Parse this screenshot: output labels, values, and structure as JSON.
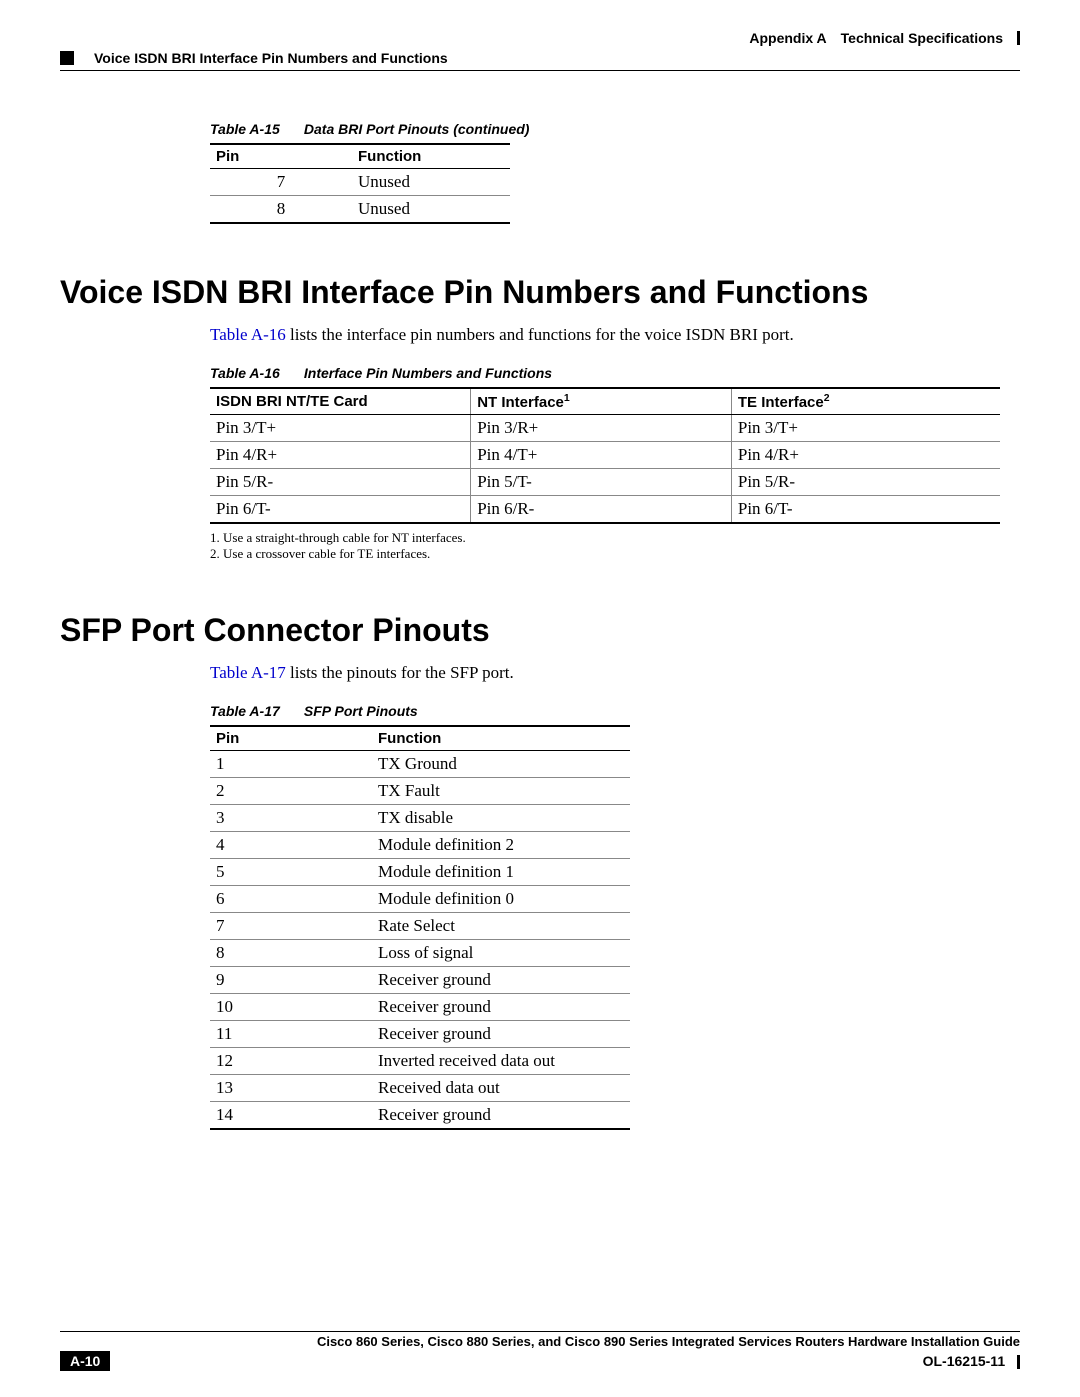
{
  "header": {
    "appendix": "Appendix A",
    "appendix_title": "Technical Specifications",
    "section_title": "Voice ISDN BRI Interface Pin Numbers and Functions"
  },
  "table_a15": {
    "number": "Table A-15",
    "title": "Data BRI Port Pinouts (continued)",
    "columns": [
      "Pin",
      "Function"
    ],
    "rows": [
      {
        "pin": "7",
        "func": "Unused"
      },
      {
        "pin": "8",
        "func": "Unused"
      }
    ]
  },
  "section1": {
    "heading": "Voice ISDN BRI Interface Pin Numbers and Functions",
    "intro_link": "Table A-16",
    "intro_rest": " lists the interface pin numbers and functions for the voice ISDN BRI port."
  },
  "table_a16": {
    "number": "Table A-16",
    "title": "Interface Pin Numbers and Functions",
    "col1": "ISDN BRI NT/TE Card",
    "col2": "NT Interface",
    "col2_sup": "1",
    "col3": "TE Interface",
    "col3_sup": "2",
    "rows": [
      {
        "c1": "Pin 3/T+",
        "c2": "Pin 3/R+",
        "c3": "Pin 3/T+"
      },
      {
        "c1": "Pin 4/R+",
        "c2": "Pin 4/T+",
        "c3": "Pin 4/R+"
      },
      {
        "c1": "Pin 5/R-",
        "c2": "Pin 5/T-",
        "c3": "Pin 5/R-"
      },
      {
        "c1": "Pin 6/T-",
        "c2": "Pin 6/R-",
        "c3": "Pin 6/T-"
      }
    ],
    "footnote1": "1.   Use a straight-through cable for NT interfaces.",
    "footnote2": "2.   Use a crossover cable for TE interfaces."
  },
  "section2": {
    "heading": "SFP Port Connector Pinouts",
    "intro_link": "Table A-17",
    "intro_rest": " lists the pinouts for the SFP port."
  },
  "table_a17": {
    "number": "Table A-17",
    "title": "SFP Port Pinouts",
    "columns": [
      "Pin",
      "Function"
    ],
    "rows": [
      {
        "pin": "1",
        "func": "TX Ground"
      },
      {
        "pin": "2",
        "func": "TX Fault"
      },
      {
        "pin": "3",
        "func": "TX disable"
      },
      {
        "pin": "4",
        "func": "Module definition 2"
      },
      {
        "pin": "5",
        "func": "Module definition 1"
      },
      {
        "pin": "6",
        "func": "Module definition 0"
      },
      {
        "pin": "7",
        "func": "Rate Select"
      },
      {
        "pin": "8",
        "func": "Loss of signal"
      },
      {
        "pin": "9",
        "func": "Receiver ground"
      },
      {
        "pin": "10",
        "func": "Receiver ground"
      },
      {
        "pin": "11",
        "func": "Receiver ground"
      },
      {
        "pin": "12",
        "func": "Inverted received data out"
      },
      {
        "pin": "13",
        "func": "Received data out"
      },
      {
        "pin": "14",
        "func": "Receiver ground"
      }
    ]
  },
  "footer": {
    "guide": "Cisco 860 Series, Cisco 880 Series, and Cisco 890 Series Integrated Services Routers Hardware Installation Guide",
    "page": "A-10",
    "doc": "OL-16215-11"
  }
}
